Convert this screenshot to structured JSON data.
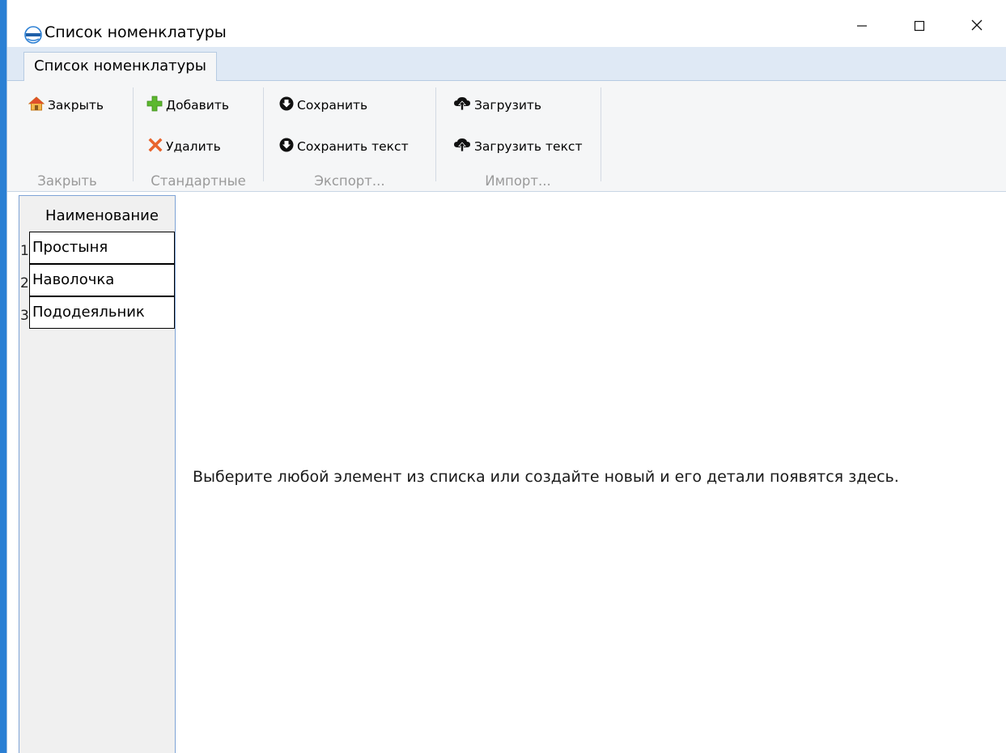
{
  "window": {
    "title": "Список номенклатуры",
    "controls": {
      "minimize": "–",
      "maximize": "□",
      "close": "✕"
    }
  },
  "ribbon": {
    "tab_label": "Список номенклатуры",
    "groups": {
      "close": {
        "label": "Закрыть",
        "buttons": {
          "close": "Закрыть"
        }
      },
      "standard": {
        "label": "Стандартные",
        "buttons": {
          "add": "Добавить",
          "delete": "Удалить"
        }
      },
      "export": {
        "label": "Экспорт...",
        "buttons": {
          "save": "Сохранить",
          "save_text": "Сохранить текст"
        }
      },
      "import": {
        "label": "Импорт...",
        "buttons": {
          "load": "Загрузить",
          "load_text": "Загрузить текст"
        }
      }
    }
  },
  "list": {
    "header": "Наименование",
    "rows": [
      {
        "num": "1",
        "name": "Простыня"
      },
      {
        "num": "2",
        "name": "Наволочка"
      },
      {
        "num": "3",
        "name": "Пододеяльник"
      }
    ]
  },
  "detail": {
    "message": "Выберите любой элемент из списка или создайте новый и его детали появятся здесь."
  },
  "icons": {
    "app": "fresh-logo-icon",
    "close": "home-icon",
    "add": "plus-icon",
    "delete": "x-cross-icon",
    "save": "download-circle-icon",
    "load": "cloud-upload-icon"
  },
  "colors": {
    "accent": "#2a7fd4",
    "tab_strip": "#dfe9f5",
    "ribbon_bg": "#f5f6f7",
    "add_green": "#5cb82e",
    "delete_orange": "#e8642c",
    "group_label": "#9a9a9a"
  }
}
